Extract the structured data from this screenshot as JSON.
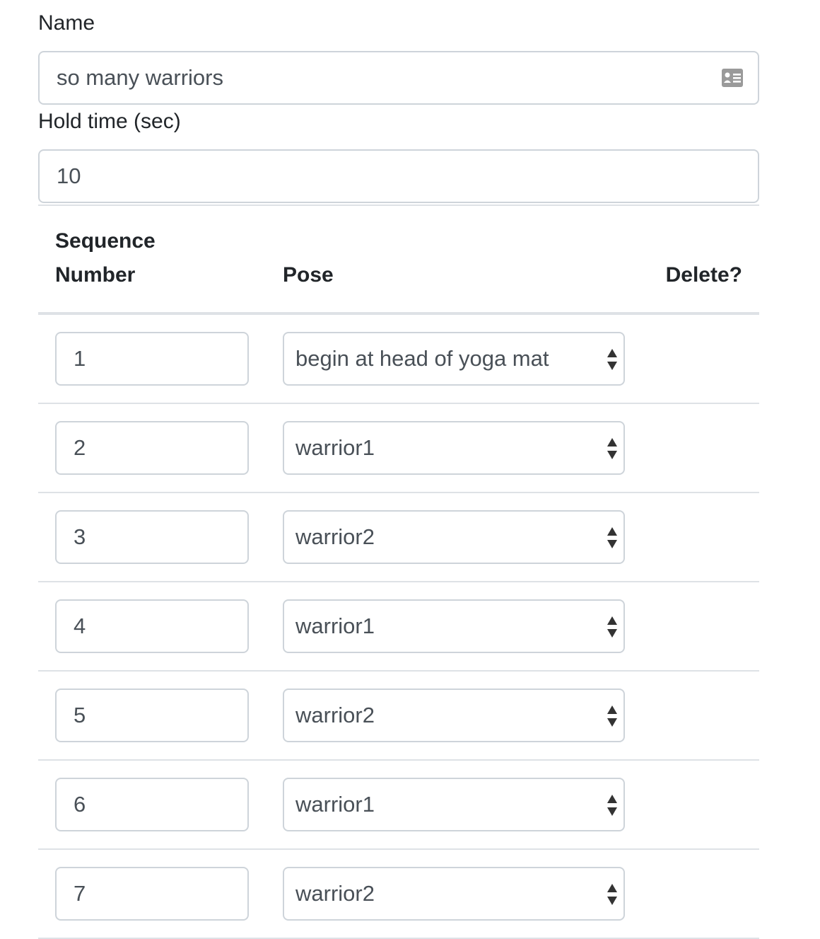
{
  "form": {
    "name_label": "Name",
    "name_value": "so many warriors",
    "hold_label": "Hold time (sec)",
    "hold_value": "10",
    "name_field_icon": "contact-card-icon"
  },
  "table": {
    "headers": {
      "sequence_line1": "Sequence",
      "sequence_line2": "Number",
      "pose": "Pose",
      "delete": "Delete?"
    },
    "rows": [
      {
        "number": "1",
        "pose": "begin at head of yoga mat"
      },
      {
        "number": "2",
        "pose": "warrior1"
      },
      {
        "number": "3",
        "pose": "warrior2"
      },
      {
        "number": "4",
        "pose": "warrior1"
      },
      {
        "number": "5",
        "pose": "warrior2"
      },
      {
        "number": "6",
        "pose": "warrior1"
      },
      {
        "number": "7",
        "pose": "warrior2"
      }
    ],
    "select_icon": "up-down-arrows-icon"
  },
  "colors": {
    "border": "#ced4da",
    "divider": "#dee2e6",
    "text": "#212529",
    "input_text": "#495057"
  }
}
